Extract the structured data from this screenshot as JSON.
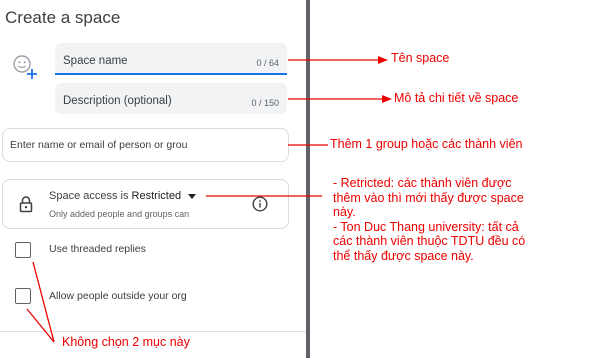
{
  "dialog": {
    "title": "Create a space",
    "space_name": {
      "placeholder": "Space name",
      "counter": "0 / 64"
    },
    "description": {
      "placeholder": "Description (optional)",
      "counter": "0 / 150"
    },
    "people_input": {
      "placeholder": "Enter name or email of person or grou"
    },
    "access": {
      "prefix": "Space access is ",
      "value": "Restricted",
      "subtitle": "Only added people and groups can"
    },
    "options": [
      {
        "label": "Use threaded replies",
        "checked": false
      },
      {
        "label": "Allow people outside your org",
        "checked": false
      }
    ]
  },
  "annotations": {
    "space_name": "Tên space",
    "description": "Mô tả chi tiết về space",
    "people": "Thêm 1 group hoặc các thành viên",
    "access_lines": [
      "- Retricted: các thành viên được",
      "thêm vào thì mới thấy được space",
      "này.",
      "- Ton Duc Thang university: tất cả",
      "các thành viên thuộc TDTU đều có",
      "thể thấy được space này."
    ],
    "checkboxes": "Không chọn 2 mục này"
  },
  "colors": {
    "annotation": "#ee0000",
    "accent": "#1a73e8",
    "divider": "#5f6368"
  }
}
